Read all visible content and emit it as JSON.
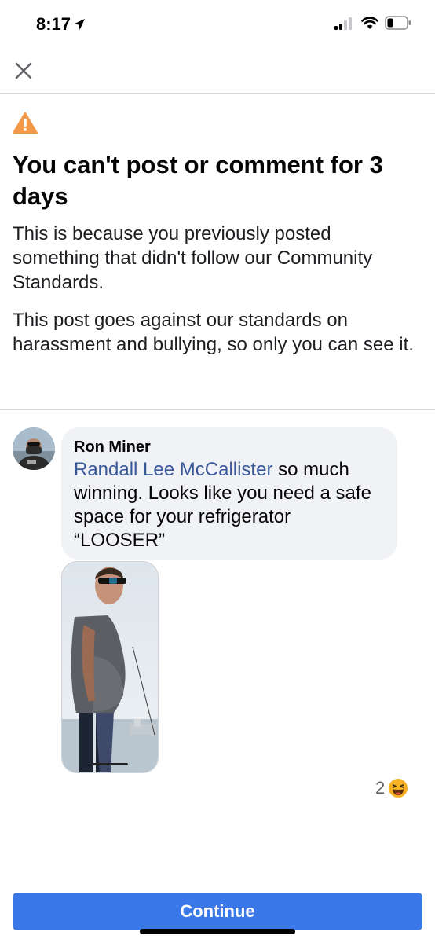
{
  "status_bar": {
    "time": "8:17",
    "icons": [
      "location-arrow-icon",
      "cellular-signal-icon",
      "wifi-icon",
      "battery-icon"
    ]
  },
  "header": {
    "close_icon": "close-icon"
  },
  "notice": {
    "icon": "warning-icon",
    "title": "You can't post or comment for 3 days",
    "paragraph_1": "This is because you previously posted something that didn't follow our Community Standards.",
    "paragraph_2": "This post goes against our standards on harassment and bullying, so only you can see it."
  },
  "comment": {
    "author": "Ron Miner",
    "mention": "Randall Lee McCallister",
    "text": " so much winning. Looks like you need a safe space for your refrigerator “LOOSER”",
    "reaction_count": "2",
    "reaction_icon": "laughing-emoji-icon"
  },
  "footer": {
    "continue_label": "Continue"
  },
  "colors": {
    "accent": "#3b78e7",
    "link": "#385898",
    "warning": "#f2994a",
    "bubble": "#f0f2f5"
  }
}
